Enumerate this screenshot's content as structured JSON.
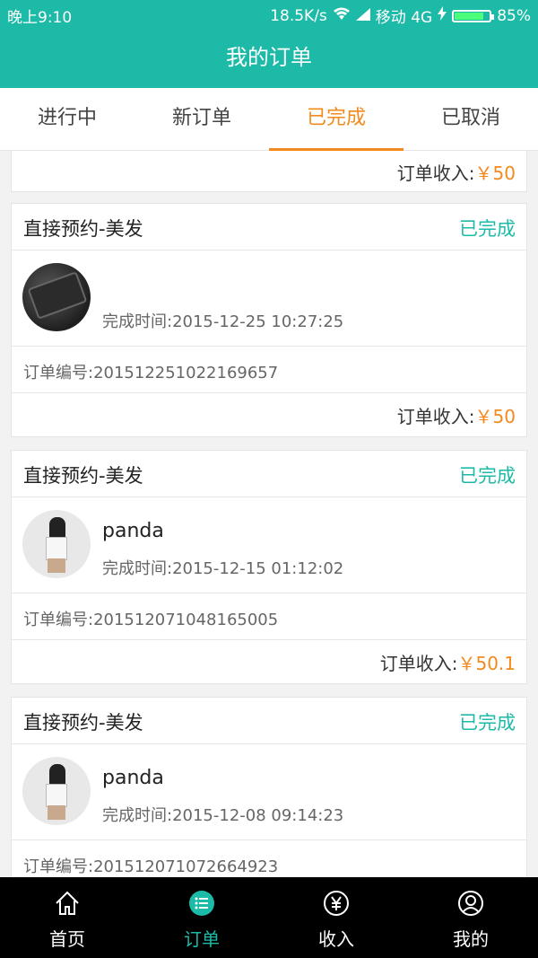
{
  "status_bar": {
    "time": "晚上9:10",
    "speed": "18.5K/s",
    "carrier": "移动 4G",
    "battery": "85%"
  },
  "app_bar": {
    "title": "我的订单"
  },
  "tabs": [
    {
      "label": "进行中",
      "active": false
    },
    {
      "label": "新订单",
      "active": false
    },
    {
      "label": "已完成",
      "active": true
    },
    {
      "label": "已取消",
      "active": false
    }
  ],
  "orders": [
    {
      "income_label": "订单收入:",
      "income_amount": "￥50"
    },
    {
      "service": "直接预约-美发",
      "status": "已完成",
      "avatar": "phone-avatar",
      "user_name": "",
      "done_time": "完成时间:2015-12-25 10:27:25",
      "order_no": "订单编号:201512251022169657",
      "income_label": "订单收入:",
      "income_amount": "￥50"
    },
    {
      "service": "直接预约-美发",
      "status": "已完成",
      "avatar": "person-avatar",
      "user_name": "panda",
      "done_time": "完成时间:2015-12-15 01:12:02",
      "order_no": "订单编号:201512071048165005",
      "income_label": "订单收入:",
      "income_amount": "￥50.1"
    },
    {
      "service": "直接预约-美发",
      "status": "已完成",
      "avatar": "person-avatar",
      "user_name": "panda",
      "done_time": "完成时间:2015-12-08 09:14:23",
      "order_no": "订单编号:201512071072664923"
    }
  ],
  "bottom_nav": [
    {
      "label": "首页",
      "icon": "home-icon",
      "active": false
    },
    {
      "label": "订单",
      "icon": "list-icon",
      "active": true
    },
    {
      "label": "收入",
      "icon": "yuan-icon",
      "active": false
    },
    {
      "label": "我的",
      "icon": "user-icon",
      "active": false
    }
  ],
  "colors": {
    "primary": "#1dbaa8",
    "accent": "#f28a1e"
  }
}
